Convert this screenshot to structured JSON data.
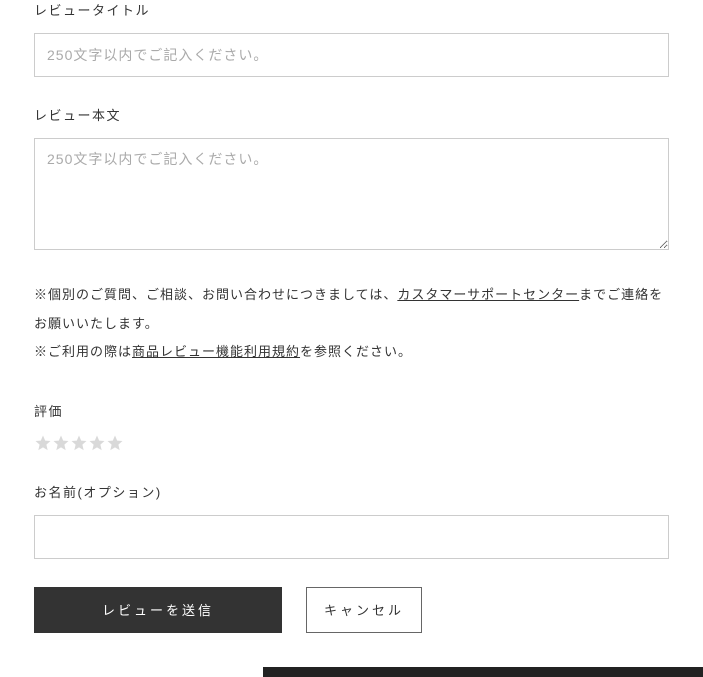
{
  "title_section": {
    "label": "レビュータイトル",
    "placeholder": "250文字以内でご記入ください。"
  },
  "body_section": {
    "label": "レビュー本文",
    "placeholder": "250文字以内でご記入ください。"
  },
  "notes": {
    "line1_prefix": "※個別のご質問、ご相談、お問い合わせにつきましては、",
    "line1_link": "カスタマーサポートセンター",
    "line1_suffix": "までご連絡をお願いいたします。",
    "line2_prefix": "※ご利用の際は",
    "line2_link": "商品レビュー機能利用規約",
    "line2_suffix": "を参照ください。"
  },
  "rating": {
    "label": "評価",
    "value": 0,
    "max": 5
  },
  "name_section": {
    "label": "お名前(オプション)"
  },
  "buttons": {
    "submit": "レビューを送信",
    "cancel": "キャンセル"
  }
}
